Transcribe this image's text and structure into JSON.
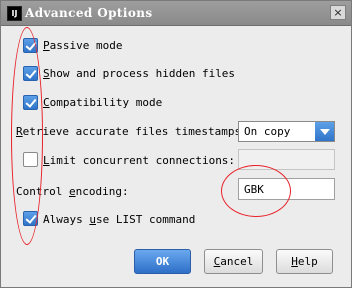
{
  "window": {
    "title": "Advanced Options",
    "app_icon": "IDE-icon",
    "close_glyph": "×"
  },
  "options": {
    "passive": {
      "prefix": "",
      "mnemonic": "P",
      "rest": "assive mode",
      "checked": true
    },
    "hidden": {
      "prefix": "",
      "mnemonic": "S",
      "rest": "how and process hidden files",
      "checked": true
    },
    "compat": {
      "prefix": "",
      "mnemonic": "C",
      "rest": "ompatibility mode",
      "checked": true
    },
    "timestamps": {
      "prefix": "",
      "mnemonic": "R",
      "rest": "etrieve accurate files timestamps:",
      "value": "On copy"
    },
    "limit": {
      "prefix": "",
      "mnemonic": "L",
      "rest": "imit concurrent connections:",
      "checked": false,
      "value": ""
    },
    "encoding": {
      "prefix": "Control ",
      "mnemonic": "e",
      "rest": "ncoding:",
      "value": "GBK"
    },
    "list_cmd": {
      "prefix": "Always ",
      "mnemonic": "u",
      "rest": "se LIST command",
      "checked": true
    }
  },
  "buttons": {
    "ok": {
      "label": "OK"
    },
    "cancel": {
      "prefix": "",
      "mnemonic": "C",
      "rest": "ancel"
    },
    "help": {
      "prefix": "",
      "mnemonic": "H",
      "rest": "elp"
    }
  },
  "colors": {
    "accent": "#2f74c9",
    "annotation": "#e8222a"
  }
}
